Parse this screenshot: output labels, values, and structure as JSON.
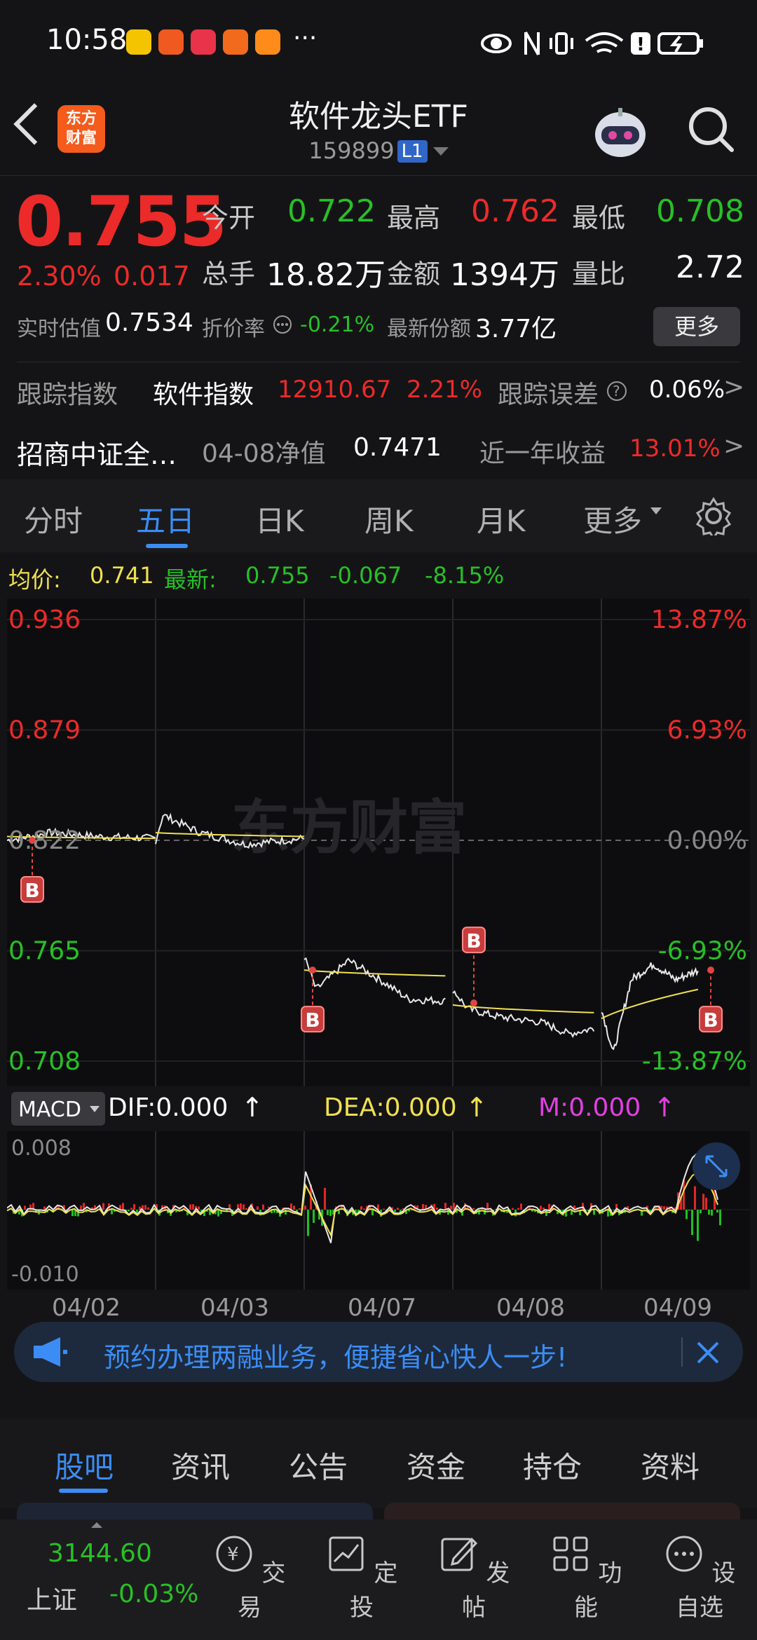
{
  "status": {
    "time": "10:58",
    "more": "···"
  },
  "header": {
    "logo_line1": "东方",
    "logo_line2": "财富",
    "title": "软件龙头ETF",
    "code": "159899",
    "level": "L1"
  },
  "quote": {
    "price": "0.755",
    "change_pct": "2.30%",
    "change": "0.017",
    "open_label": "今开",
    "open": "0.722",
    "high_label": "最高",
    "high": "0.762",
    "low_label": "最低",
    "low": "0.708",
    "volume_label": "总手",
    "volume": "18.82万",
    "amount_label": "金额",
    "amount": "1394万",
    "ratio_label": "量比",
    "ratio": "2.72",
    "est_label": "实时估值",
    "est": "0.7534",
    "discount_label": "折价率",
    "discount": "-0.21%",
    "shares_label": "最新份额",
    "shares": "3.77亿",
    "more_button": "更多"
  },
  "tracking": {
    "index_label": "跟踪指数",
    "index_name": "软件指数",
    "index_value": "12910.67",
    "index_pct": "2.21%",
    "error_label": "跟踪误差",
    "error_value": "0.06%",
    "fund_name": "招商中证全…",
    "nav_label": "04-08净值",
    "nav_value": "0.7471",
    "year_label": "近一年收益",
    "year_value": "13.01%"
  },
  "chart_tabs": [
    "分时",
    "五日",
    "日K",
    "周K",
    "月K",
    "更多"
  ],
  "chart_info": {
    "avg_label": "均价:",
    "avg": "0.741",
    "latest_label": "最新:",
    "latest": "0.755",
    "chg": "-0.067",
    "chg_pct": "-8.15%"
  },
  "chart_data": {
    "type": "line",
    "title": "",
    "x": [
      "04/02",
      "04/03",
      "04/07",
      "04/08",
      "04/09"
    ],
    "ylim": [
      0.708,
      0.936
    ],
    "y_ticks_left": [
      "0.936",
      "0.879",
      "0.822",
      "0.765",
      "0.708"
    ],
    "y_ticks_right": [
      "13.87%",
      "6.93%",
      "0.00%",
      "-6.93%",
      "-13.87%"
    ],
    "series": [],
    "buy_markers": [
      "B",
      "B",
      "B",
      "B"
    ],
    "watermark": "东方财富"
  },
  "macd": {
    "label": "MACD",
    "dif": "DIF:0.000",
    "dea": "DEA:0.000",
    "m": "M:0.000",
    "arrow": "↑",
    "ytop": "0.008",
    "ybottom": "-0.010"
  },
  "dates": [
    "04/02",
    "04/03",
    "04/07",
    "04/08",
    "04/09"
  ],
  "banner": {
    "text": "预约办理两融业务，便捷省心快人一步!"
  },
  "bottom_tabs": [
    "股吧",
    "资讯",
    "公告",
    "资金",
    "持仓",
    "资料"
  ],
  "bottom_nav": {
    "index_value": "3144.60",
    "index_name": "上证",
    "index_pct": "-0.03%",
    "items": [
      "交易",
      "定投",
      "发帖",
      "功能",
      "设自选"
    ]
  },
  "colors": {
    "up": "#ec2a2a",
    "down": "#27c027",
    "accent": "#3b8df5",
    "avg_line": "#f0e050"
  }
}
